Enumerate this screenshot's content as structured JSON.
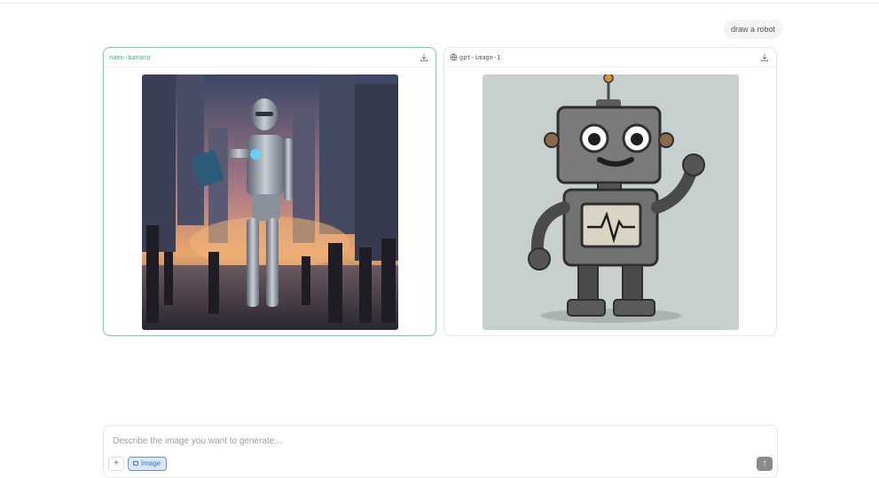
{
  "chat": {
    "user_message": "draw a robot"
  },
  "results": [
    {
      "model": "nano-banana",
      "selected": true,
      "image_icon": "futuristic-robot-city-image"
    },
    {
      "model": "gpt-image-1",
      "selected": false,
      "image_icon": "cartoon-robot-image"
    }
  ],
  "composer": {
    "placeholder": "Describe the image you want to generate...",
    "value": "",
    "plus_label": "+",
    "mode_chip_label": "Image",
    "send_icon": "arrow-up-icon"
  },
  "colors": {
    "selected_border": "#7fd1a4",
    "model_label_active": "#3fb27f",
    "chip_bg": "#dbe7ff",
    "chip_border": "#6a8fe0"
  }
}
